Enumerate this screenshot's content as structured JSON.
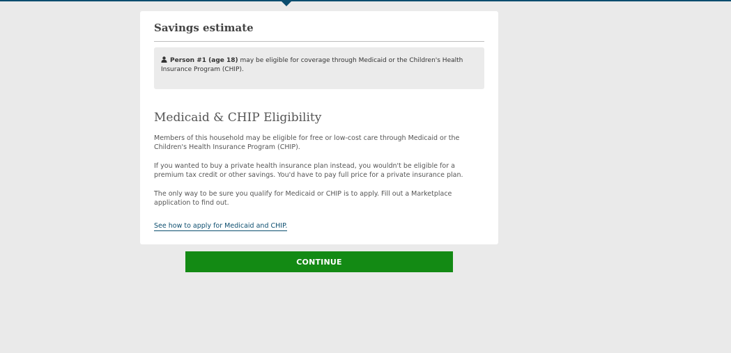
{
  "header": {
    "accent_color": "#0b4d6e"
  },
  "savings": {
    "title": "Savings estimate",
    "notice": {
      "icon": "person-icon",
      "person": "Person #1 (age 18)",
      "text": " may be eligible for coverage through Medicaid or the Children's Health Insurance Program (CHIP)."
    }
  },
  "eligibility": {
    "title": "Medicaid & CHIP Eligibility",
    "paragraphs": [
      "Members of this household may be eligible for free or low-cost care through Medicaid or the Children's Health Insurance Program (CHIP).",
      "If you wanted to buy a private health insurance plan instead, you wouldn't be eligible for a premium tax credit or other savings. You'd have to pay full price for a private insurance plan.",
      "The only way to be sure you qualify for Medicaid or CHIP is to apply. Fill out a Marketplace application to find out."
    ],
    "link_label": "See how to apply for Medicaid and CHIP."
  },
  "actions": {
    "continue_label": "CONTINUE",
    "continue_color": "#138a14"
  }
}
